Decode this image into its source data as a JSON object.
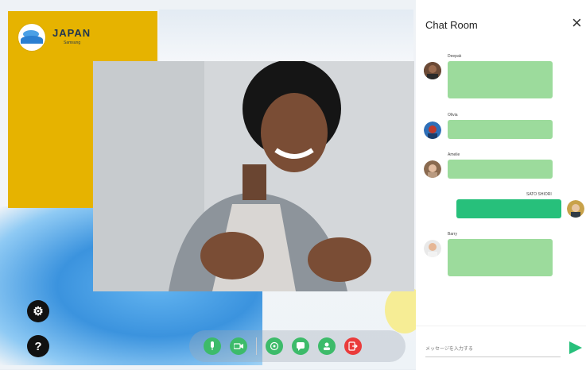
{
  "brand": {
    "name": "JAPAN",
    "subtitle": "Samsung"
  },
  "chat": {
    "title": "Chat Room",
    "close_symbol": "×",
    "messages": [
      {
        "name": "Deepak",
        "side": "left"
      },
      {
        "name": "Olivia",
        "side": "left"
      },
      {
        "name": "Amelie",
        "side": "left"
      },
      {
        "name": "SATO SHIORI",
        "side": "right"
      },
      {
        "name": "Barry",
        "side": "left"
      }
    ],
    "input_placeholder": "メッセージを入力する"
  },
  "controls": {
    "settings_symbol": "⚙",
    "help_symbol": "?",
    "toolbar_icons": [
      "mic-icon",
      "camera-icon",
      "share-icon",
      "chat-icon",
      "participants-icon",
      "leave-icon"
    ]
  },
  "colors": {
    "accent": "#27c07b",
    "bubble": "#9cdb9c",
    "leave": "#ea3b3b",
    "brand_panel": "#e6b300"
  }
}
